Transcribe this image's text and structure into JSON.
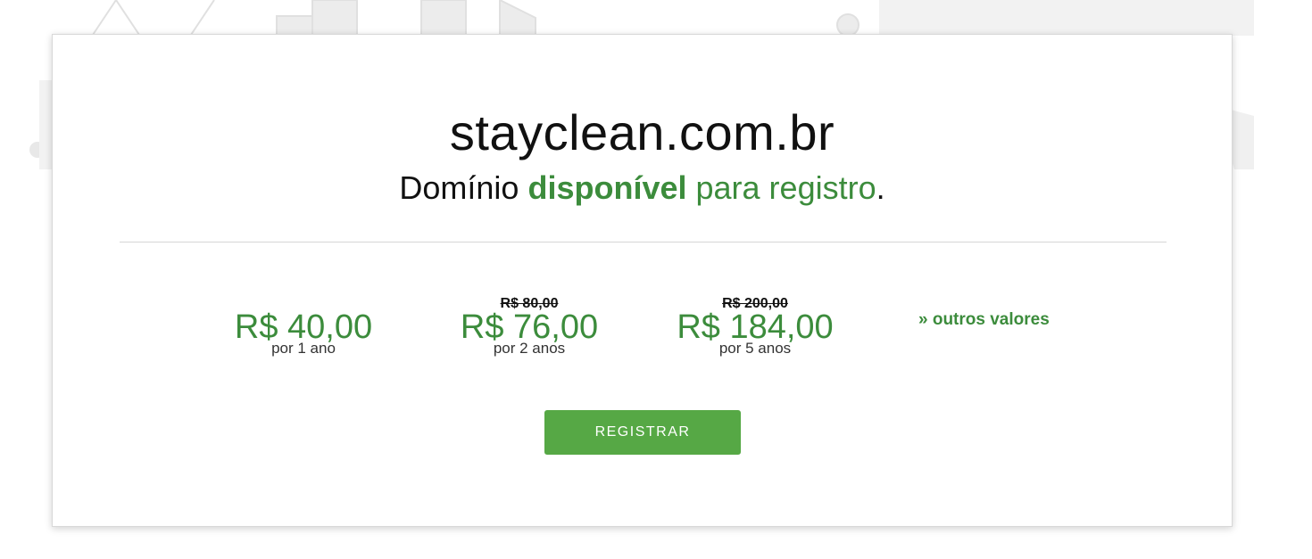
{
  "domain": {
    "name": "stayclean.com.br"
  },
  "status": {
    "prefix": "Domínio",
    "highlight": "disponível",
    "suffix": "para registro",
    "period": "."
  },
  "prices": [
    {
      "old": "",
      "amount": "R$ 40,00",
      "period": "por 1 ano"
    },
    {
      "old": "R$ 80,00",
      "amount": "R$ 76,00",
      "period": "por 2 anos"
    },
    {
      "old": "R$ 200,00",
      "amount": "R$ 184,00",
      "period": "por 5 anos"
    }
  ],
  "links": {
    "other_values": "» outros valores"
  },
  "actions": {
    "register_label": "REGISTRAR"
  },
  "colors": {
    "accent_green": "#3c8c3c",
    "button_green": "#56a845"
  }
}
